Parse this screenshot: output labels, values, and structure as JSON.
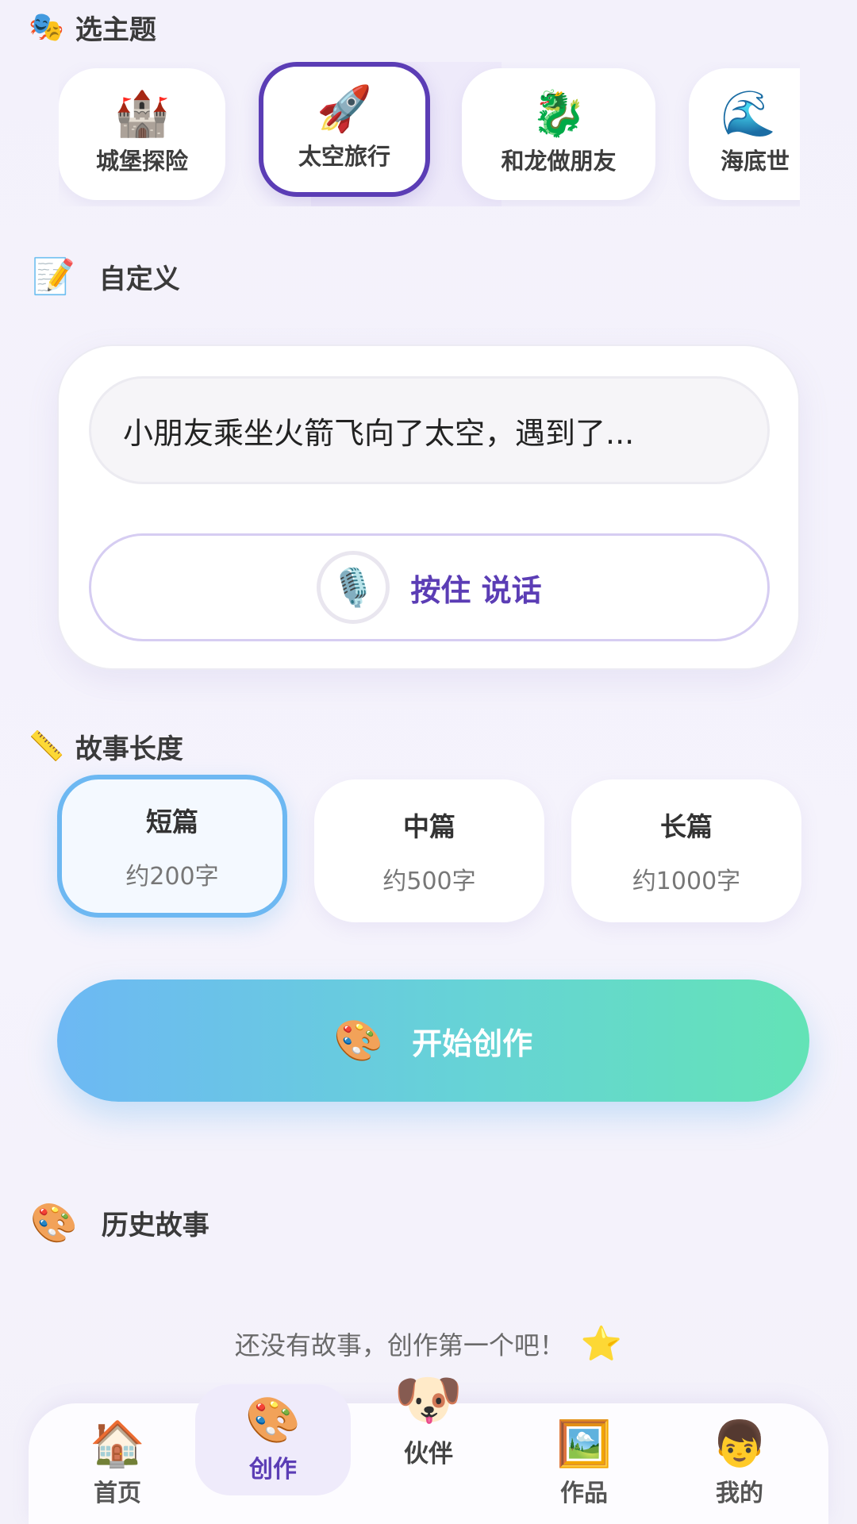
{
  "theme_section": {
    "emoji": "🎭",
    "title": "选主题"
  },
  "themes": [
    {
      "emoji": "🏰",
      "label": "城堡探险"
    },
    {
      "emoji": "🚀",
      "label": "太空旅行",
      "selected": true
    },
    {
      "emoji": "🐉",
      "label": "和龙做朋友"
    },
    {
      "emoji": "🌊",
      "label": "海底世"
    }
  ],
  "custom_section": {
    "emoji": "📝",
    "title": "自定义"
  },
  "custom": {
    "prompt_value": "小朋友乘坐火箭飞向了太空，遇到了...",
    "voice_icon": "🎙️",
    "voice_label": "按住 说话"
  },
  "length_section": {
    "emoji": "📏",
    "title": "故事长度"
  },
  "lengths": [
    {
      "name": "短篇",
      "desc": "约200字",
      "selected": true
    },
    {
      "name": "中篇",
      "desc": "约500字"
    },
    {
      "name": "长篇",
      "desc": "约1000字"
    }
  ],
  "start_button": {
    "emoji": "🎨",
    "label": "开始创作"
  },
  "history_section": {
    "emoji": "🎨",
    "title": "历史故事"
  },
  "empty_hint": {
    "text": "还没有故事，创作第一个吧！",
    "emoji": "⭐"
  },
  "nav": [
    {
      "icon": "🏠",
      "label": "首页"
    },
    {
      "icon": "🎨",
      "label": "创作",
      "active": true
    },
    {
      "icon": "🐶",
      "label": "伙伴"
    },
    {
      "icon": "🖼️",
      "label": "作品"
    },
    {
      "icon": "👦",
      "label": "我的"
    }
  ],
  "colors": {
    "accent": "#5b3db5",
    "selected_length_border": "#6db8f2",
    "start_gradient_from": "#6db8f4",
    "start_gradient_to": "#63e3b6"
  }
}
